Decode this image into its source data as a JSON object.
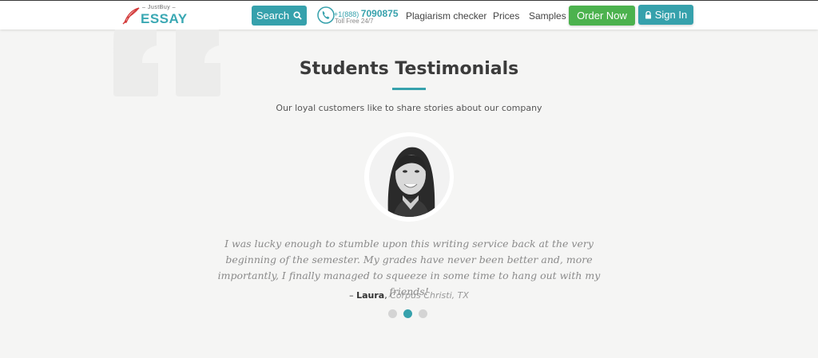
{
  "header": {
    "logo_top": "– JustBuy –",
    "logo_main": "ESSAY",
    "search_label": "Search",
    "phone_prefix": "+1(888)",
    "phone_number": "7090875",
    "phone_sub": "Toll Free 24/7",
    "nav": [
      {
        "label": "Plagiarism checker"
      },
      {
        "label": "Prices"
      },
      {
        "label": "Samples"
      }
    ],
    "order_label": "Order Now",
    "signin_label": "Sign In"
  },
  "testimonials": {
    "title": "Students Testimonials",
    "subtitle": "Our loyal customers like to share stories about our company",
    "quote": "I was lucky enough to stumble upon this writing service back at the very beginning of the semester. My grades have never been better and, more importantly, I finally managed to squeeze in some time to hang out with my friends!",
    "author_dash": "– ",
    "author_name": "Laura",
    "author_location": "Corpus Christi, TX",
    "slides": 3,
    "active_slide": 2
  },
  "colors": {
    "accent": "#36a1ac",
    "order": "#4cb24e",
    "background": "#f5f5f4"
  },
  "icons": {
    "search": "magnifier-icon",
    "phone": "phone-icon",
    "lock": "lock-icon",
    "logo": "quill-icon",
    "decor": "quote-mark-icon"
  }
}
